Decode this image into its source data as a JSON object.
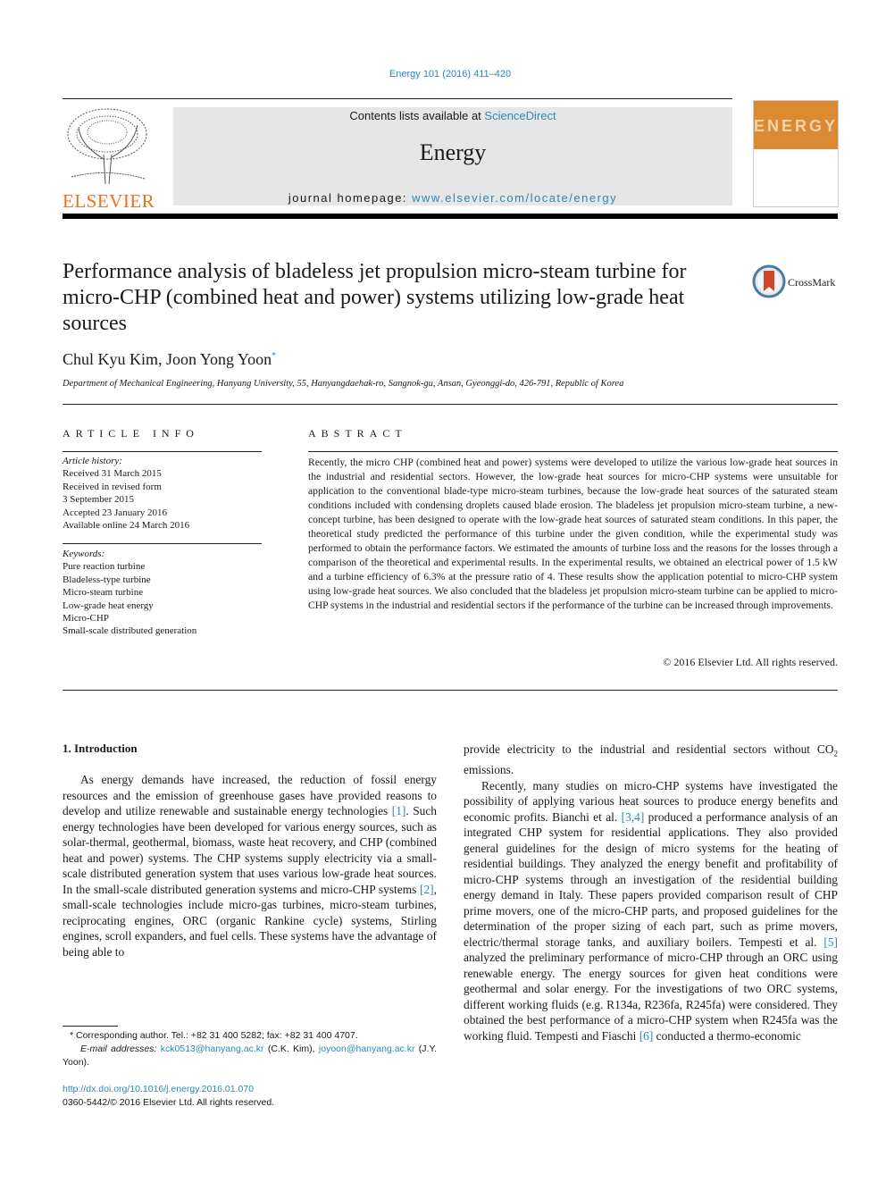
{
  "header": {
    "citation": "Energy 101 (2016) 411–420",
    "contents_prefix": "Contents lists available at ",
    "contents_link": "ScienceDirect",
    "journal_name": "Energy",
    "homepage_prefix": "journal homepage: ",
    "homepage_link": "www.elsevier.com/locate/energy",
    "publisher_logo": "ELSEVIER",
    "cover_title": "ENERGY",
    "brand_color": "#e9711c",
    "link_color": "#2a88b8"
  },
  "article": {
    "title": "Performance analysis of bladeless jet propulsion micro-steam turbine for micro-CHP (combined heat and power) systems utilizing low-grade heat sources",
    "crossmark_label": "CrossMark",
    "authors": "Chul Kyu Kim, Joon Yong Yoon",
    "author_mark": "*",
    "affiliation": "Department of Mechanical Engineering, Hanyang University, 55, Hanyangdaehak-ro, Sangnok-gu, Ansan, Gyeonggi-do, 426-791, Republic of Korea"
  },
  "article_info": {
    "heading": "ARTICLE INFO",
    "history_label": "Article history:",
    "history": [
      "Received 31 March 2015",
      "Received in revised form",
      "3 September 2015",
      "Accepted 23 January 2016",
      "Available online 24 March 2016"
    ],
    "keywords_label": "Keywords:",
    "keywords": [
      "Pure reaction turbine",
      "Bladeless-type turbine",
      "Micro-steam turbine",
      "Low-grade heat energy",
      "Micro-CHP",
      "Small-scale distributed generation"
    ]
  },
  "abstract": {
    "heading": "ABSTRACT",
    "text": "Recently, the micro CHP (combined heat and power) systems were developed to utilize the various low-grade heat sources in the industrial and residential sectors. However, the low-grade heat sources for micro-CHP systems were unsuitable for application to the conventional blade-type micro-steam turbines, because the low-grade heat sources of the saturated steam conditions included with condensing droplets caused blade erosion. The bladeless jet propulsion micro-steam turbine, a new-concept turbine, has been designed to operate with the low-grade heat sources of saturated steam conditions. In this paper, the theoretical study predicted the performance of this turbine under the given condition, while the experimental study was performed to obtain the performance factors. We estimated the amounts of turbine loss and the reasons for the losses through a comparison of the theoretical and experimental results. In the experimental results, we obtained an electrical power of 1.5 kW and a turbine efficiency of 6.3% at the pressure ratio of 4. These results show the application potential to micro-CHP system using low-grade heat sources. We also concluded that the bladeless jet propulsion micro-steam turbine can be applied to micro-CHP systems in the industrial and residential sectors if the performance of the turbine can be increased through improvements.",
    "copyright": "© 2016 Elsevier Ltd. All rights reserved."
  },
  "intro": {
    "heading": "1.  Introduction",
    "left_p1_a": "As energy demands have increased, the reduction of fossil energy resources and the emission of greenhouse gases have provided reasons to develop and utilize renewable and sustainable energy technologies ",
    "ref1": "[1]",
    "left_p1_b": ". Such energy technologies have been developed for various energy sources, such as solar-thermal, geothermal, biomass, waste heat recovery, and CHP (combined heat and power) systems. The CHP systems supply electricity via a small-scale distributed generation system that uses various low-grade heat sources. In the small-scale distributed generation systems and micro-CHP systems ",
    "ref2": "[2]",
    "left_p1_c": ", small-scale technologies include micro-gas turbines, micro-steam turbines, reciprocating engines, ORC (organic Rankine cycle) systems, Stirling engines, scroll expanders, and fuel cells. These systems have the advantage of being able to",
    "right_p0_a": "provide electricity to the industrial and residential sectors without CO",
    "right_p0_sub": "2",
    "right_p0_b": " emissions.",
    "right_p1_a": "Recently, many studies on micro-CHP systems have investigated the possibility of applying various heat sources to produce energy benefits and economic profits. Bianchi et al. ",
    "ref34": "[3,4]",
    "right_p1_b": " produced a performance analysis of an integrated CHP system for residential applications. They also provided general guidelines for the design of micro systems for the heating of residential buildings. They analyzed the energy benefit and profitability of micro-CHP systems through an investigation of the residential building energy demand in Italy. These papers provided comparison result of CHP prime movers, one of the micro-CHP parts, and proposed guidelines for the determination of the proper sizing of each part, such as prime movers, electric/thermal storage tanks, and auxiliary boilers. Tempesti et al. ",
    "ref5": "[5]",
    "right_p1_c": " analyzed the preliminary performance of micro-CHP through an ORC using renewable energy. The energy sources for given heat conditions were geothermal and solar energy. For the investigations of two ORC systems, different working fluids (e.g. R134a, R236fa, R245fa) were considered. They obtained the best performance of a micro-CHP system when R245fa was the working fluid. Tempesti and Fiaschi ",
    "ref6": "[6]",
    "right_p1_d": " conducted a thermo-economic"
  },
  "footnotes": {
    "corresponding": "* Corresponding author. Tel.: +82 31 400 5282; fax: +82 31 400 4707.",
    "email_label": "E-mail addresses:",
    "email1": "kck0513@hanyang.ac.kr",
    "email1_owner": " (C.K. Kim), ",
    "email2": "joyoon@hanyang.ac.kr",
    "email2_owner": "(J.Y. Yoon).",
    "doi": "http://dx.doi.org/10.1016/j.energy.2016.01.070",
    "issn": "0360-5442/© 2016 Elsevier Ltd. All rights reserved."
  }
}
